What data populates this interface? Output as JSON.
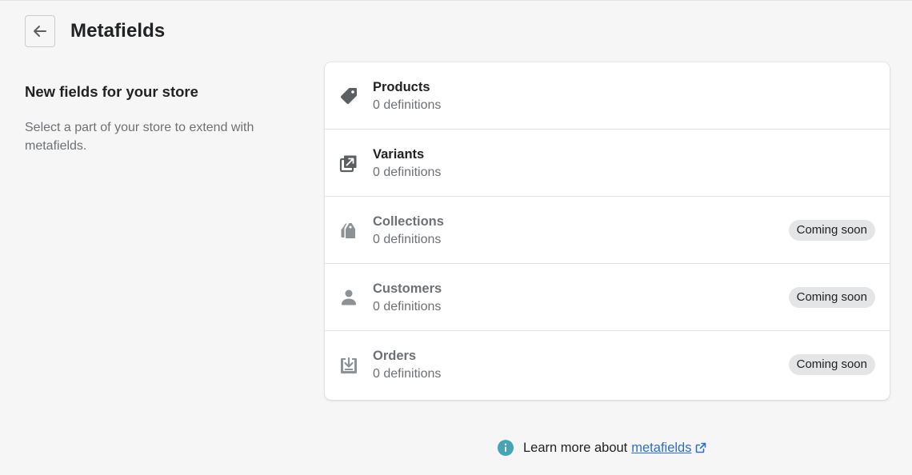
{
  "page": {
    "title": "Metafields",
    "back_icon": "arrow-left-icon"
  },
  "annotation": {
    "title": "New fields for your store",
    "description": "Select a part of your store to extend with metafields."
  },
  "resources": [
    {
      "name": "Products",
      "count": "0 definitions",
      "icon": "tag-icon",
      "enabled": true,
      "badge": ""
    },
    {
      "name": "Variants",
      "count": "0 definitions",
      "icon": "variants-icon",
      "enabled": true,
      "badge": ""
    },
    {
      "name": "Collections",
      "count": "0 definitions",
      "icon": "collections-icon",
      "enabled": false,
      "badge": "Coming soon"
    },
    {
      "name": "Customers",
      "count": "0 definitions",
      "icon": "customer-icon",
      "enabled": false,
      "badge": "Coming soon"
    },
    {
      "name": "Orders",
      "count": "0 definitions",
      "icon": "orders-icon",
      "enabled": false,
      "badge": "Coming soon"
    }
  ],
  "footer": {
    "text": "Learn more about",
    "link_text": "metafields",
    "info_icon": "info-icon",
    "external_icon": "external-link-icon"
  },
  "colors": {
    "background": "#f6f6f7",
    "card": "#ffffff",
    "text_primary": "#202223",
    "text_subdued": "#6d7175",
    "icon_enabled": "#5c5f62",
    "icon_disabled": "#8c9196",
    "badge_bg": "#e4e5e7",
    "link": "#2c6ecb",
    "info": "#47a4b5"
  }
}
